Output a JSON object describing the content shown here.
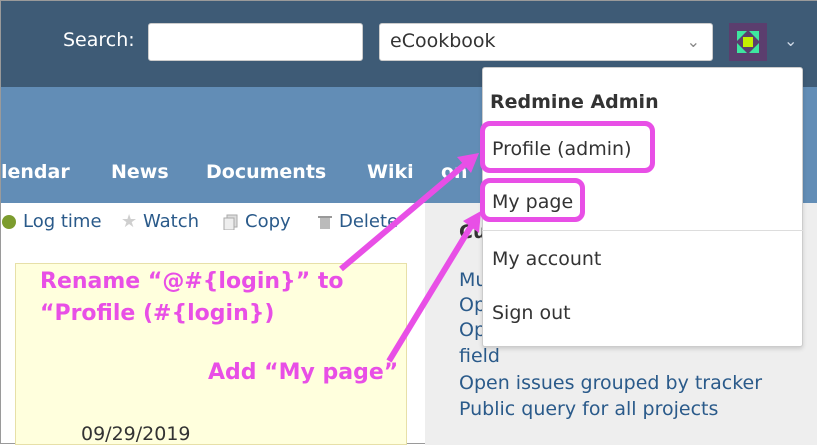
{
  "header": {
    "search_label": "Search:",
    "search_value": "",
    "project_select": "eCookbook"
  },
  "menu": [
    "lendar",
    "News",
    "Documents",
    "Wiki",
    "on"
  ],
  "toolbar": {
    "log_time": "Log time",
    "watch": "Watch",
    "copy": "Copy",
    "delete": "Delete"
  },
  "note": {
    "date": "09/29/2019"
  },
  "sidebar": {
    "heading": "Cu",
    "links": [
      "Mu",
      "Op",
      "Op",
      "field",
      "Open issues grouped by tracker",
      "Public query for all projects"
    ]
  },
  "dropdown": {
    "title": "Redmine Admin",
    "items": [
      "Profile (admin)",
      "My page",
      "My account",
      "Sign out"
    ]
  },
  "annotations": {
    "rename_line1": "Rename “@#{login}” to",
    "rename_line2": "“Profile (#{login})",
    "add": "Add “My page”"
  },
  "colors": {
    "topbar": "#3e5b76",
    "header": "#628db6",
    "annotation": "#e84fe6",
    "link": "#2a5a8a"
  }
}
